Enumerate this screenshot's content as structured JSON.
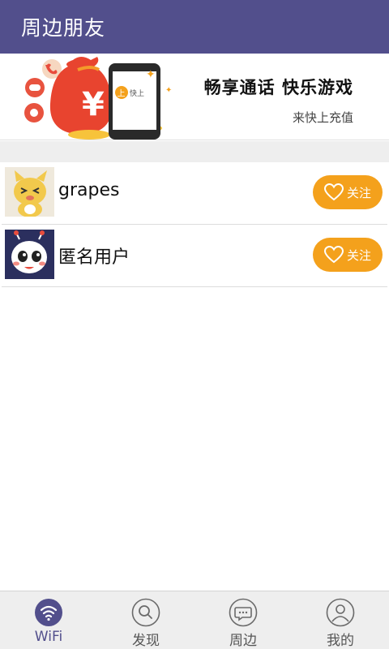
{
  "header": {
    "title": "周边朋友"
  },
  "banner": {
    "slogan": "畅享通话 快乐游戏",
    "sub": "来快上充值",
    "phone_brand": "快上",
    "phone_badge": "上",
    "bag_symbol": "¥"
  },
  "friends": [
    {
      "name": "grapes",
      "follow_label": "关注",
      "avatar_icon": "yellow-cartoon-cat"
    },
    {
      "name": "匿名用户",
      "follow_label": "关注",
      "avatar_icon": "white-robot-mascot"
    }
  ],
  "tabs": [
    {
      "label": "WiFi",
      "icon": "wifi-icon",
      "active": true
    },
    {
      "label": "发现",
      "icon": "search-icon",
      "active": false
    },
    {
      "label": "周边",
      "icon": "chat-icon",
      "active": false
    },
    {
      "label": "我的",
      "icon": "user-icon",
      "active": false
    }
  ],
  "colors": {
    "header": "#524f8c",
    "accent": "#f4a11c",
    "tab_bg": "#eeeeee"
  }
}
